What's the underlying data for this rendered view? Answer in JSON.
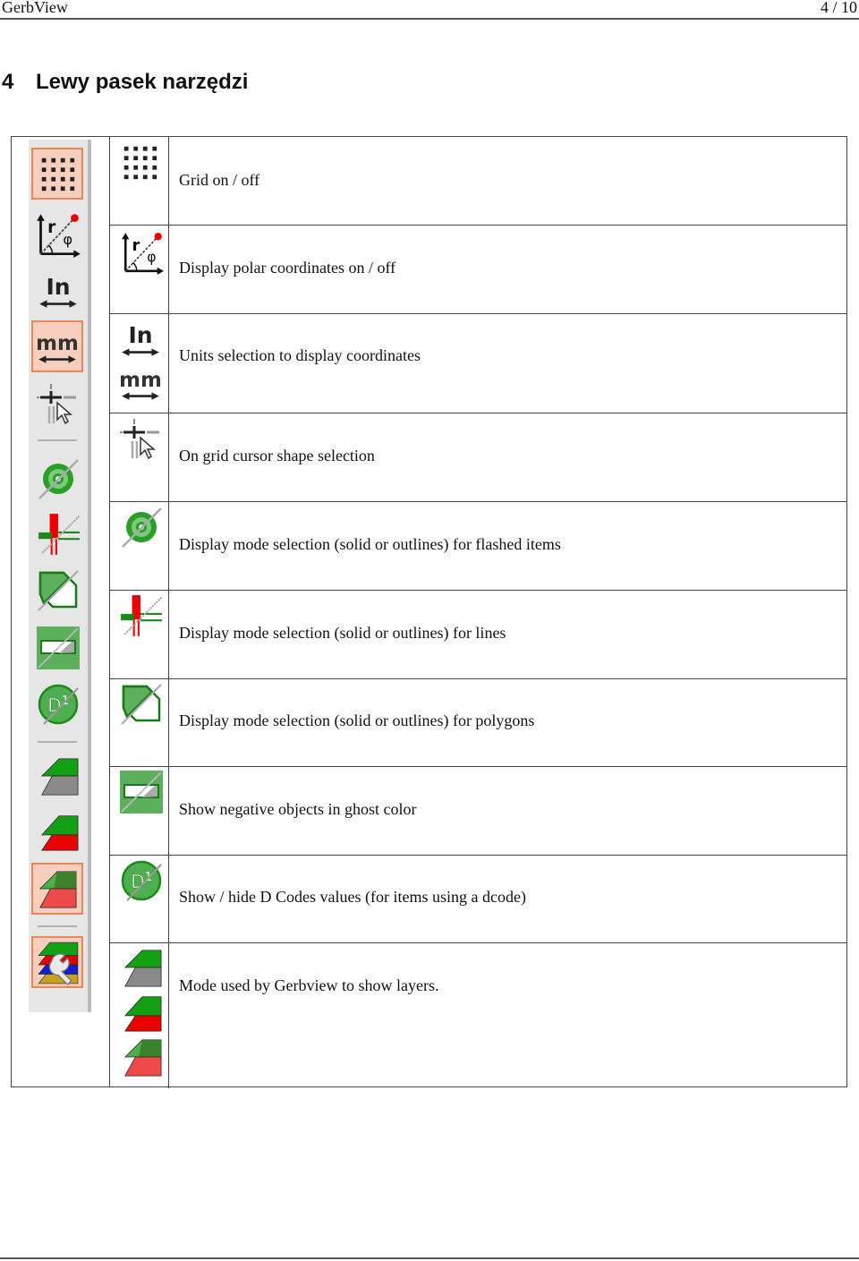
{
  "header": {
    "doc_title": "GerbView",
    "page_indicator": "4 / 10"
  },
  "section": {
    "number": "4",
    "title": "Lewy pasek narzędzi"
  },
  "toolbar": {
    "buttons": [
      {
        "icon": "grid-icon",
        "active": true
      },
      {
        "icon": "polar-coordinates-icon",
        "active": false
      },
      {
        "icon": "units-inch-icon",
        "active": false
      },
      {
        "icon": "units-mm-icon",
        "active": true
      },
      {
        "icon": "cursor-shape-icon",
        "active": false
      },
      {
        "icon": "flashed-items-display-icon",
        "active": false
      },
      {
        "icon": "lines-display-icon",
        "active": false
      },
      {
        "icon": "polygons-display-icon",
        "active": false
      },
      {
        "icon": "negative-objects-icon",
        "active": false
      },
      {
        "icon": "dcodes-icon",
        "active": false
      },
      {
        "icon": "layers-mode-gray-icon",
        "active": false
      },
      {
        "icon": "layers-mode-red-icon",
        "active": false
      },
      {
        "icon": "layers-mode-transparent-icon",
        "active": true
      },
      {
        "icon": "layers-manager-icon",
        "active": true
      }
    ]
  },
  "rows": [
    {
      "icon": "grid-icon",
      "description": "Grid on / off"
    },
    {
      "icon": "polar-coordinates-icon",
      "description": "Display polar coordinates on / off"
    },
    {
      "icon": "units-selection-icon",
      "description": "Units selection to display coordinates"
    },
    {
      "icon": "cursor-shape-icon",
      "description": "On grid cursor shape selection"
    },
    {
      "icon": "flashed-items-display-icon",
      "description": "Display mode selection (solid or outlines) for flashed items"
    },
    {
      "icon": "lines-display-icon",
      "description": "Display mode selection (solid or outlines) for lines"
    },
    {
      "icon": "polygons-display-icon",
      "description": "Display mode selection (solid or outlines) for polygons"
    },
    {
      "icon": "negative-objects-icon",
      "description": "Show negative objects in ghost color"
    },
    {
      "icon": "dcodes-icon",
      "description": "Show / hide D Codes values (for items using a dcode)"
    },
    {
      "icon": "layers-mode-icon",
      "description": "Mode used by Gerbview to show layers."
    }
  ],
  "colors": {
    "active_bg": "#f8cfbf",
    "active_border": "#e8875a",
    "green": "#1e9a1e",
    "light_green": "#5cb85c",
    "red": "#e00000",
    "gray": "#8a8a8a"
  }
}
